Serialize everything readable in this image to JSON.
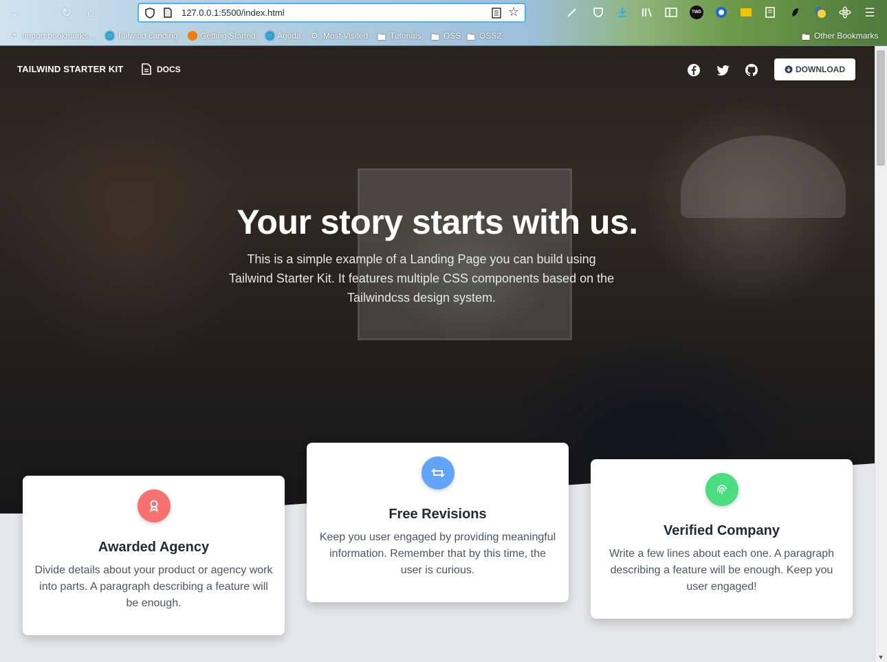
{
  "browser": {
    "url": "127.0.0.1:5500/index.html",
    "bookmarks": [
      "Import bookmarks...",
      "Tailwind Landing",
      "Getting Started",
      "Agoda",
      "Most Visited",
      "Tutorials",
      "OSS",
      "OSS2"
    ],
    "other_bookmarks": "Other Bookmarks",
    "toolbar_icon_text": "TWD"
  },
  "nav": {
    "brand": "TAILWIND STARTER KIT",
    "docs_label": "DOCS",
    "download_label": "DOWNLOAD",
    "social_icons": [
      "facebook-icon",
      "twitter-icon",
      "github-icon"
    ]
  },
  "hero": {
    "title": "Your story starts with us.",
    "subtitle": "This is a simple example of a Landing Page you can build using Tailwind Starter Kit. It features multiple CSS components based on the Tailwindcss design system."
  },
  "features": [
    {
      "icon": "award-icon",
      "color": "#f87171",
      "title": "Awarded Agency",
      "text": "Divide details about your product or agency work into parts. A paragraph describing a feature will be enough."
    },
    {
      "icon": "retweet-icon",
      "color": "#60a5fa",
      "title": "Free Revisions",
      "text": "Keep you user engaged by providing meaningful information. Remember that by this time, the user is curious."
    },
    {
      "icon": "fingerprint-icon",
      "color": "#4ade80",
      "title": "Verified Company",
      "text": "Write a few lines about each one. A paragraph describing a feature will be enough. Keep you user engaged!"
    }
  ]
}
